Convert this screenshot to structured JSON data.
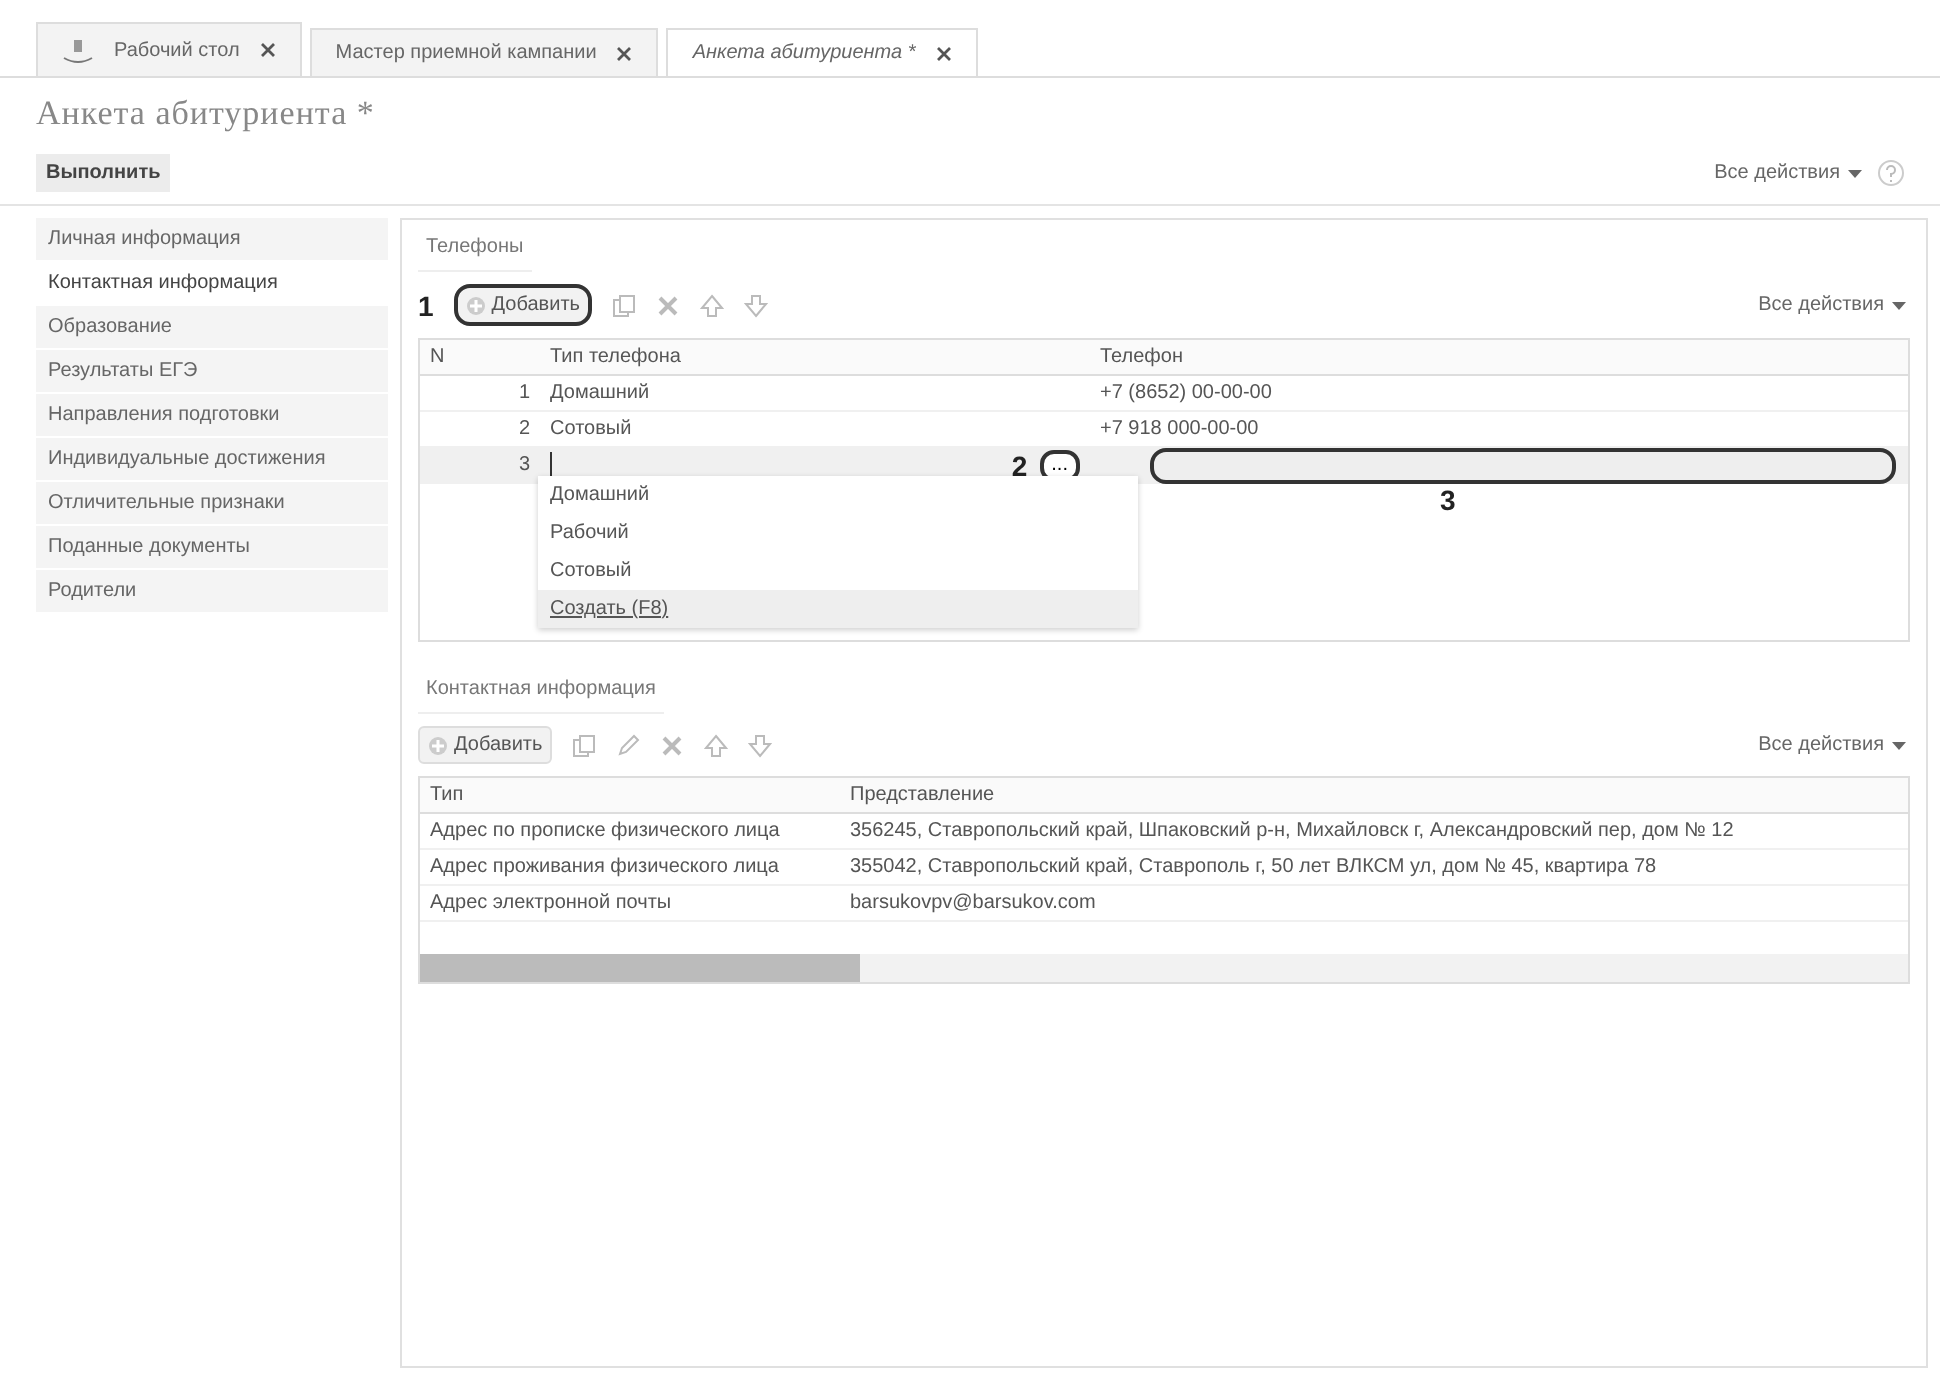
{
  "tabs": [
    {
      "label": "Рабочий стол",
      "selected": false
    },
    {
      "label": "Мастер приемной кампании",
      "selected": false
    },
    {
      "label": "Анкета абитуриента *",
      "selected": true
    }
  ],
  "title": "Анкета абитуриента *",
  "toolbar": {
    "run_button": "Выполнить",
    "all_actions": "Все действия"
  },
  "sidebar": {
    "items": [
      {
        "label": "Личная информация",
        "selected": false
      },
      {
        "label": "Контактная информация",
        "selected": true
      },
      {
        "label": "Образование",
        "selected": false
      },
      {
        "label": "Результаты ЕГЭ",
        "selected": false
      },
      {
        "label": "Направления подготовки",
        "selected": false
      },
      {
        "label": "Индивидуальные достижения",
        "selected": false
      },
      {
        "label": "Отличительные признаки",
        "selected": false
      },
      {
        "label": "Поданные документы",
        "selected": false
      },
      {
        "label": "Родители",
        "selected": false
      }
    ]
  },
  "phones": {
    "title": "Телефоны",
    "add_button": "Добавить",
    "all_actions": "Все действия",
    "columns": [
      "N",
      "Тип телефона",
      "Телефон"
    ],
    "rows": [
      {
        "n": "1",
        "type": "Домашний",
        "phone": "+7 (8652) 00-00-00"
      },
      {
        "n": "2",
        "type": "Сотовый",
        "phone": "+7 918 000-00-00"
      }
    ],
    "edit_row": {
      "n": "3",
      "choice_button": "...",
      "dropdown": [
        "Домашний",
        "Рабочий",
        "Сотовый"
      ],
      "create_link": "Создать (F8)"
    },
    "callouts": [
      "1",
      "2",
      "3"
    ]
  },
  "contacts": {
    "title": "Контактная информация",
    "add_button": "Добавить",
    "all_actions": "Все действия",
    "columns": [
      "Тип",
      "Представление"
    ],
    "rows": [
      {
        "type": "Адрес по прописке физического лица",
        "value": "356245, Ставропольский край, Шпаковский р-н, Михайловск г, Александровский пер, дом № 12"
      },
      {
        "type": "Адрес проживания физического лица",
        "value": "355042, Ставропольский край, Ставрополь г, 50 лет ВЛКСМ ул, дом № 45, квартира 78"
      },
      {
        "type": "Адрес электронной почты",
        "value": "barsukovpv@barsukov.com"
      }
    ]
  }
}
